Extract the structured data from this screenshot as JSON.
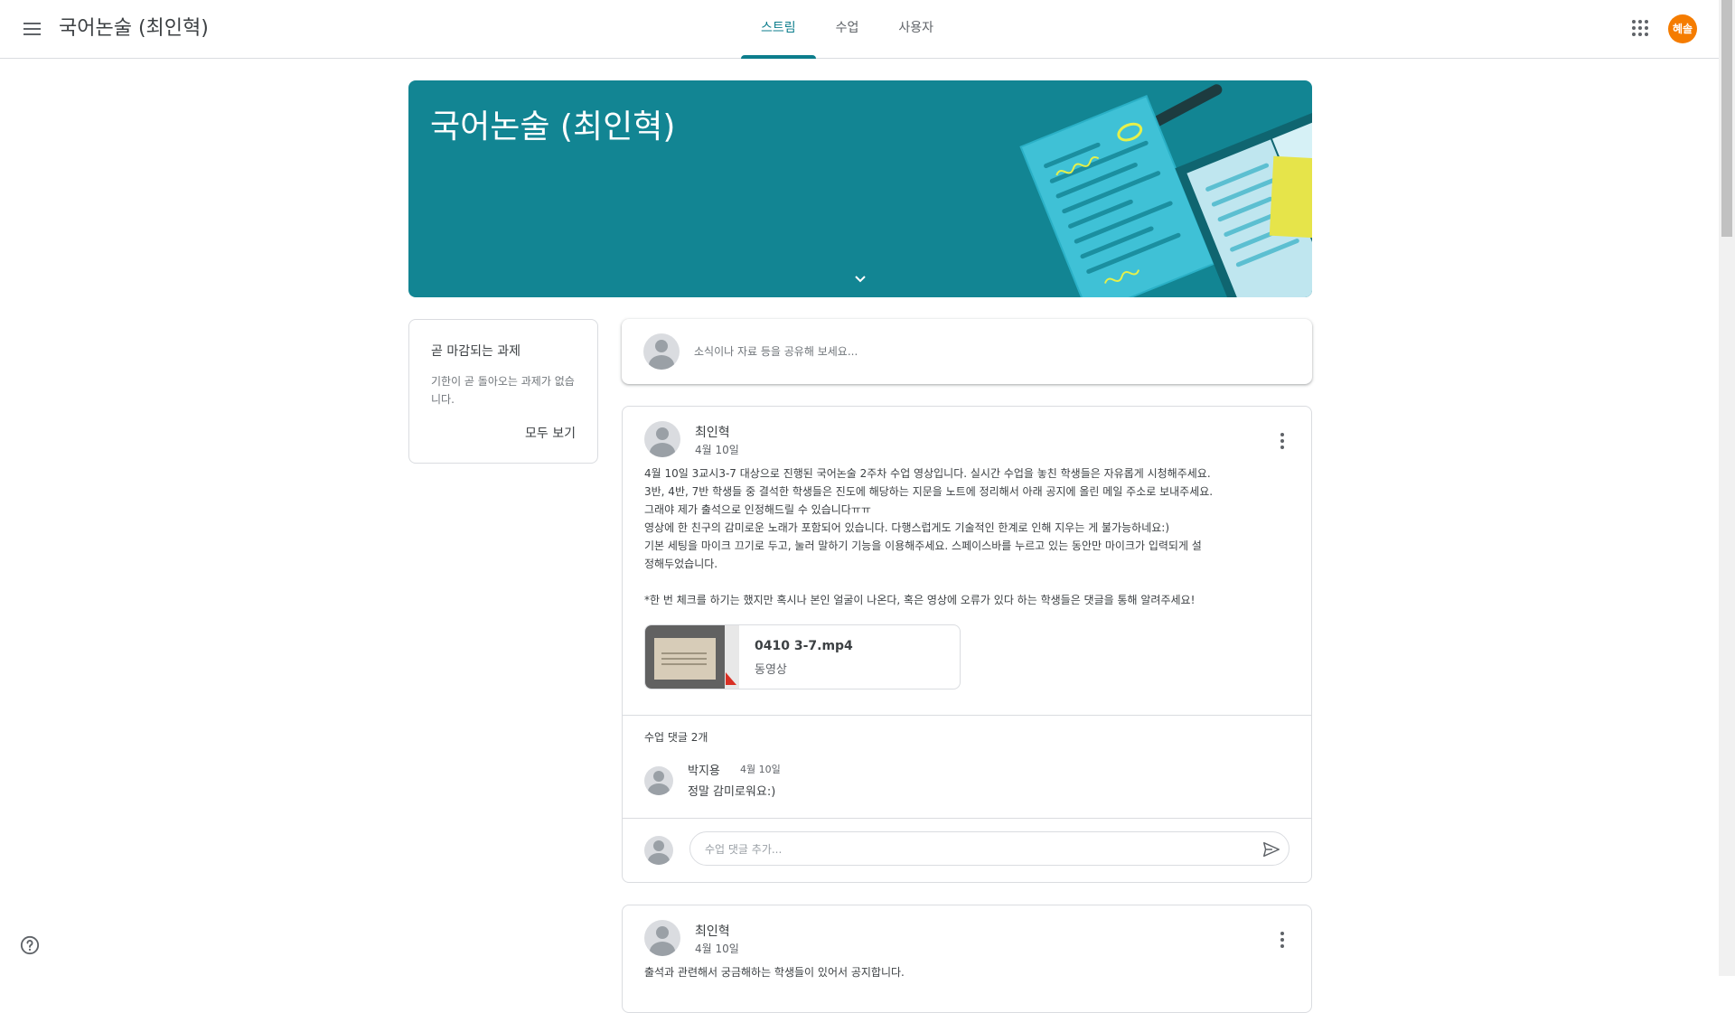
{
  "header": {
    "class_title": "국어논술 (최인혁)",
    "tabs": [
      {
        "label": "스트림",
        "active": true
      },
      {
        "label": "수업",
        "active": false
      },
      {
        "label": "사용자",
        "active": false
      }
    ],
    "user_initials": "혜솔",
    "user_avatar_color": "#f57c00",
    "icons": [
      "menu-icon",
      "apps-grid-icon"
    ]
  },
  "banner": {
    "title": "국어논술 (최인혁)",
    "color": "#128593"
  },
  "upcoming": {
    "title": "곧 마감되는 과제",
    "empty_text": "기한이 곧 돌아오는 과제가 없습니다.",
    "view_all": "모두 보기"
  },
  "share": {
    "placeholder": "소식이나 자료 등을 공유해 보세요..."
  },
  "posts": [
    {
      "author": "최인혁",
      "date": "4월 10일",
      "body": "4월 10일 3교시3-7 대상으로 진행된 국어논술 2주차 수업 영상입니다. 실시간 수업을 놓친 학생들은 자유롭게 시청해주세요.\n3반, 4반, 7반 학생들 중 결석한 학생들은 진도에 해당하는 지문을 노트에 정리해서 아래 공지에 올린 메일 주소로 보내주세요.\n그래야 제가 출석으로 인정해드릴 수 있습니다ㅠㅠ\n영상에 한 친구의 감미로운 노래가 포함되어 있습니다. 다행스럽게도 기술적인 한계로 인해 지우는 게 불가능하네요:)\n기본 세팅을 마이크 끄기로 두고, 눌러 말하기 기능을 이용해주세요. 스페이스바를 누르고 있는 동안만 마이크가 입력되게 설\n정해두었습니다.\n\n*한 번 체크를 하기는 했지만 혹시나 본인 얼굴이 나온다, 혹은 영상에 오류가 있다 하는 학생들은 댓글을 통해 알려주세요!",
      "attachment": {
        "name": "0410 3-7.mp4",
        "type": "동영상"
      },
      "comments_count_label": "수업 댓글 2개",
      "comments": [
        {
          "author": "박지용",
          "date": "4월 10일",
          "text": "정말 감미로워요:)"
        }
      ],
      "comment_placeholder": "수업 댓글 추가..."
    },
    {
      "author": "최인혁",
      "date": "4월 10일",
      "body": "출석과 관련해서 궁금해하는 학생들이 있어서 공지합니다."
    }
  ],
  "accent_color": "#0c7d8c"
}
